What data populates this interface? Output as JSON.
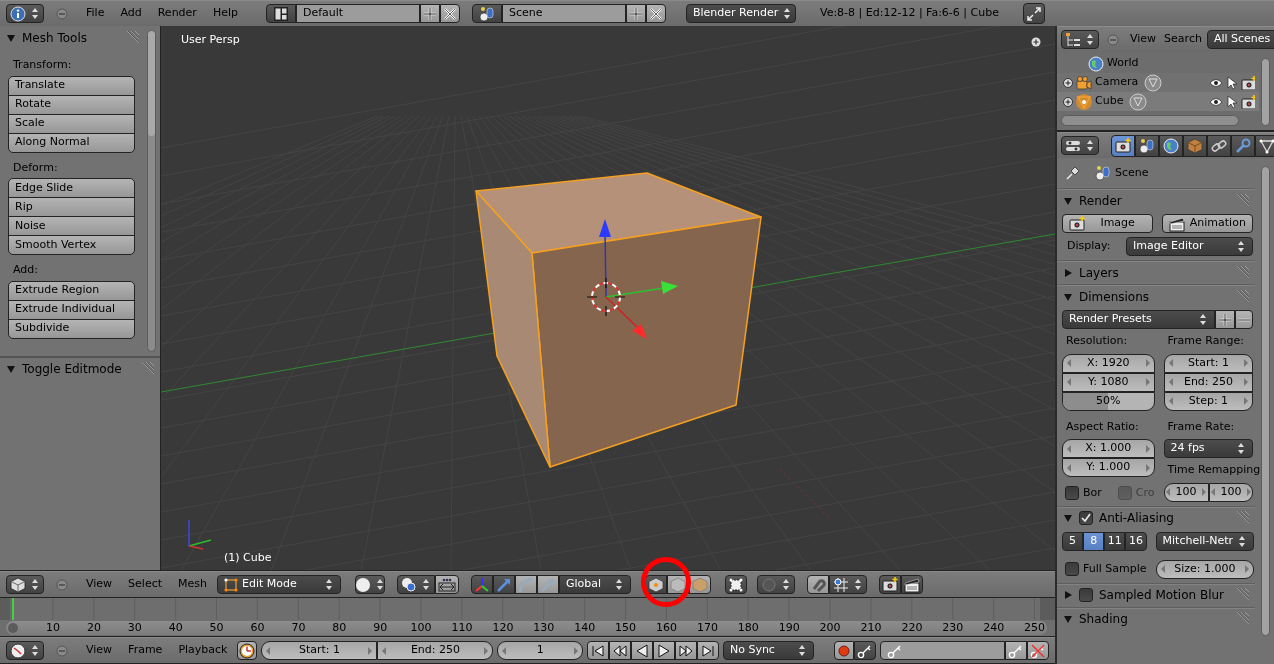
{
  "info_header": {
    "menus": [
      "File",
      "Add",
      "Render",
      "Help"
    ],
    "screen_layout": "Default",
    "scene": "Scene",
    "render_engine": "Blender Render",
    "stats": "Ve:8-8 | Ed:12-12 | Fa:6-6 | Cube"
  },
  "tool_shelf": {
    "panels": [
      {
        "title": "Mesh Tools",
        "expanded": true,
        "groups": [
          {
            "label": "Transform:",
            "buttons": [
              "Translate",
              "Rotate",
              "Scale",
              "Along Normal"
            ]
          },
          {
            "label": "Deform:",
            "buttons": [
              "Edge Slide",
              "Rip",
              "Noise",
              "Smooth Vertex"
            ]
          },
          {
            "label": "Add:",
            "buttons": [
              "Extrude Region",
              "Extrude Individual",
              "Subdivide"
            ]
          }
        ]
      },
      {
        "title": "Toggle Editmode",
        "expanded": true
      }
    ]
  },
  "viewport": {
    "view_name": "User Persp",
    "object_label": "(1) Cube"
  },
  "view3d_header": {
    "menus": [
      "View",
      "Select",
      "Mesh"
    ],
    "mode": "Edit Mode",
    "orientation": "Global"
  },
  "timeline": {
    "frame_labels": [
      "10",
      "20",
      "30",
      "40",
      "50",
      "60",
      "70",
      "80",
      "90",
      "100",
      "110",
      "120",
      "130",
      "140",
      "150",
      "160",
      "170",
      "180",
      "190",
      "200",
      "210",
      "220",
      "230",
      "240",
      "250"
    ]
  },
  "timeline_header": {
    "menus": [
      "View",
      "Frame",
      "Playback"
    ],
    "start": "Start: 1",
    "end": "End: 250",
    "current_frame": "1",
    "sync": "No Sync"
  },
  "outliner": {
    "menus": [
      "View",
      "Search"
    ],
    "display_mode": "All Scenes",
    "items": [
      {
        "name": "World",
        "kind": "world",
        "selected": false
      },
      {
        "name": "Camera",
        "kind": "camera",
        "selected": false
      },
      {
        "name": "Cube",
        "kind": "mesh",
        "selected": true
      }
    ]
  },
  "properties": {
    "tabs": [
      {
        "kind": "render",
        "selected": true
      },
      {
        "kind": "scene",
        "selected": false
      },
      {
        "kind": "world",
        "selected": false
      },
      {
        "kind": "object",
        "selected": false
      },
      {
        "kind": "constraints",
        "selected": false
      },
      {
        "kind": "modifiers",
        "selected": false
      },
      {
        "kind": "data",
        "selected": false
      }
    ],
    "context": "Scene",
    "panels": [
      {
        "kind": "render",
        "title": "Render",
        "expanded": true,
        "buttons": [
          "Image",
          "Animation"
        ],
        "display_label": "Display:",
        "display": "Image Editor"
      },
      {
        "title": "Layers",
        "expanded": false
      },
      {
        "kind": "dimensions",
        "title": "Dimensions",
        "expanded": true,
        "presets": "Render Presets",
        "resolution_label": "Resolution:",
        "resolution_x": "X: 1920",
        "resolution_y": "Y: 1080",
        "resolution_percent": "50%",
        "level": 0.5,
        "frame_range_label": "Frame Range:",
        "frame_start": "Start: 1",
        "frame_end": "End: 250",
        "frame_step": "Step: 1",
        "aspect_label": "Aspect Ratio:",
        "aspect_x": "X: 1.000",
        "aspect_y": "Y: 1.000",
        "frame_rate_label": "Frame Rate:",
        "frame_rate": "24 fps",
        "time_remap_label": "Time Remapping",
        "remap_old": "100",
        "remap_new": "100",
        "options": [
          {
            "label": "Bor",
            "checked": false,
            "disabled": false
          },
          {
            "label": "Cro",
            "checked": false,
            "disabled": true
          }
        ]
      },
      {
        "kind": "anti_aliasing",
        "title": "Anti-Aliasing",
        "expanded": true,
        "enabled": true,
        "samples": [
          {
            "label": "5",
            "selected": false
          },
          {
            "label": "8",
            "selected": true
          },
          {
            "label": "11",
            "selected": false
          },
          {
            "label": "16",
            "selected": false
          }
        ],
        "filter": "Mitchell-Netr",
        "full_sample": {
          "label": "Full Sample",
          "checked": false
        },
        "size": "Size: 1.000"
      },
      {
        "title": "Sampled Motion Blur",
        "expanded": false,
        "enabled": false
      },
      {
        "title": "Shading",
        "expanded": true
      }
    ]
  }
}
